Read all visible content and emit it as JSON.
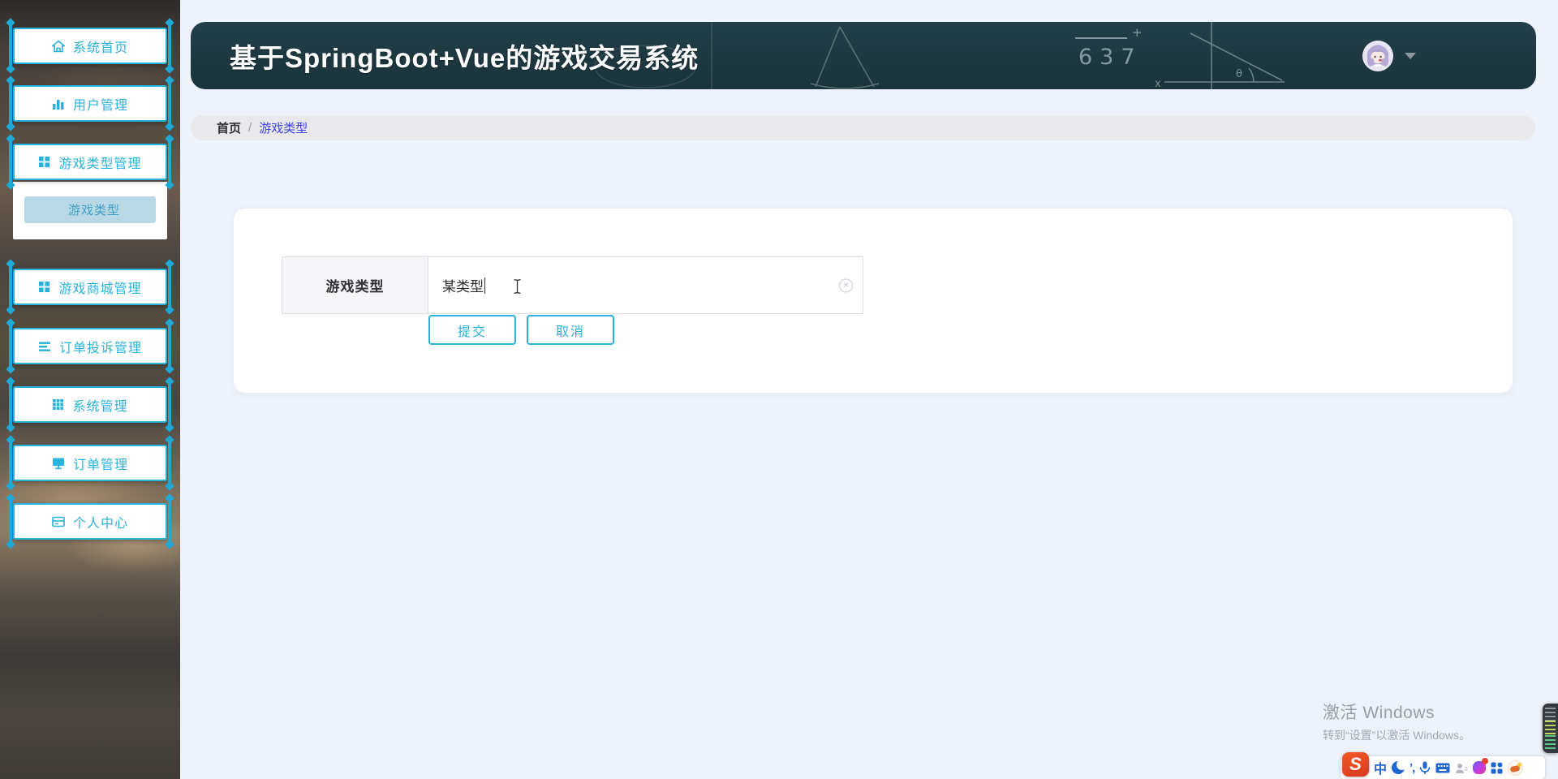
{
  "app": {
    "title": "基于SpringBoot+Vue的游戏交易系统"
  },
  "header": {
    "chalk": {
      "numbers": "637",
      "plus": "+",
      "theta": "θ",
      "x_label": "x"
    },
    "avatar": "user-avatar"
  },
  "sidebar": {
    "items": [
      {
        "label": "系统首页",
        "icon": "home-icon"
      },
      {
        "label": "用户管理",
        "icon": "bar-chart-icon"
      },
      {
        "label": "游戏类型管理",
        "icon": "grid-2x2-icon",
        "submenu": [
          {
            "label": "游戏类型",
            "active": true
          }
        ]
      },
      {
        "label": "游戏商城管理",
        "icon": "grid-2x2-icon"
      },
      {
        "label": "订单投诉管理",
        "icon": "list-icon"
      },
      {
        "label": "系统管理",
        "icon": "grid-3x3-icon"
      },
      {
        "label": "订单管理",
        "icon": "monitor-icon"
      },
      {
        "label": "个人中心",
        "icon": "card-icon"
      }
    ]
  },
  "breadcrumb": {
    "home": "首页",
    "separator": "/",
    "current": "游戏类型"
  },
  "form": {
    "label": "游戏类型",
    "value": "某类型",
    "submit_label": "提交",
    "cancel_label": "取消"
  },
  "watermark": {
    "line1": "激活 Windows",
    "line2": "转到“设置”以激活 Windows。"
  },
  "taskbar": {
    "ime_logo": "S",
    "lang_indicator": "中",
    "punctuation": "’,"
  },
  "colors": {
    "accent": "#29b2dc",
    "header_bg": "#1e3840",
    "breadcrumb_link": "#3c41e8",
    "submenu_active_bg": "#b7d8e4",
    "submenu_active_text": "#3f9fc0",
    "page_bg": "#eef2fa",
    "card_bg": "#ffffff",
    "sidebar_item_border": "#29b2dc"
  }
}
